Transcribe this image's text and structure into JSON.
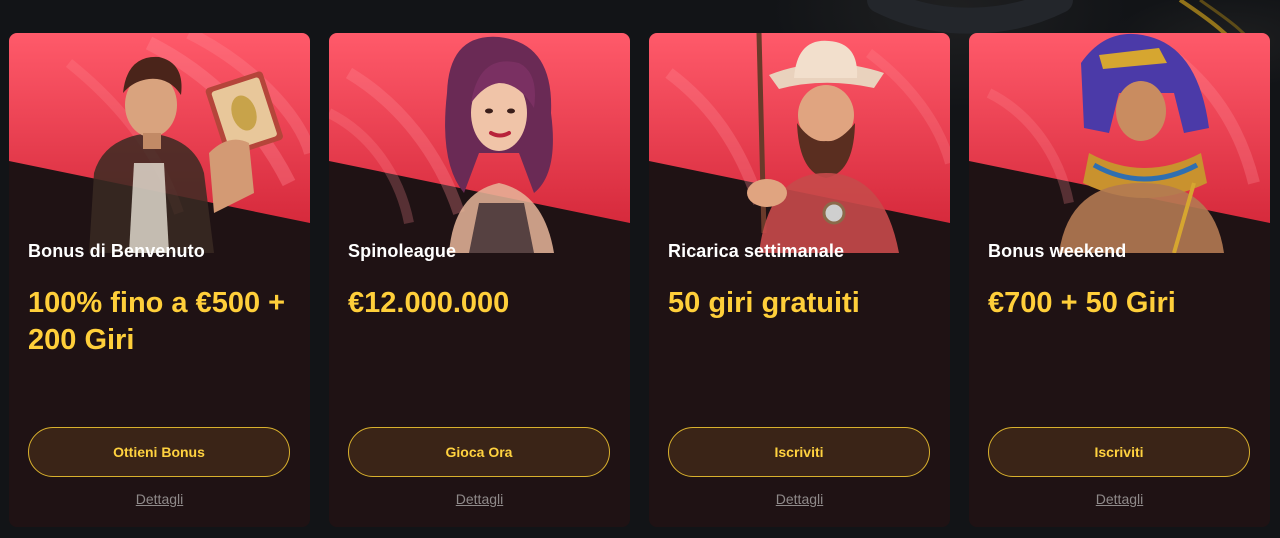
{
  "colors": {
    "page_bg": "#121417",
    "card_top": "#ff5566",
    "card_bottom": "#1f1214",
    "offer_text": "#ffcf3a",
    "button_border": "#d9b12d",
    "button_bg": "#3a2417",
    "details_text": "#8f8a8a"
  },
  "cards": [
    {
      "character": "adventurer-with-book",
      "title": "Bonus di Benvenuto",
      "offer": "100% fino a €500 + 200 Giri",
      "button_label": "Ottieni Bonus",
      "details_label": "Dettagli"
    },
    {
      "character": "purple-haired-woman",
      "title": "Spinoleague",
      "offer": "€12.000.000",
      "button_label": "Gioca Ora",
      "details_label": "Dettagli"
    },
    {
      "character": "bearded-cowboy-fisherman",
      "title": "Ricarica settimanale",
      "offer": "50 giri gratuiti",
      "button_label": "Iscriviti",
      "details_label": "Dettagli"
    },
    {
      "character": "pharaoh",
      "title": "Bonus weekend",
      "offer": "€700 + 50 Giri",
      "button_label": "Iscriviti",
      "details_label": "Dettagli"
    }
  ]
}
